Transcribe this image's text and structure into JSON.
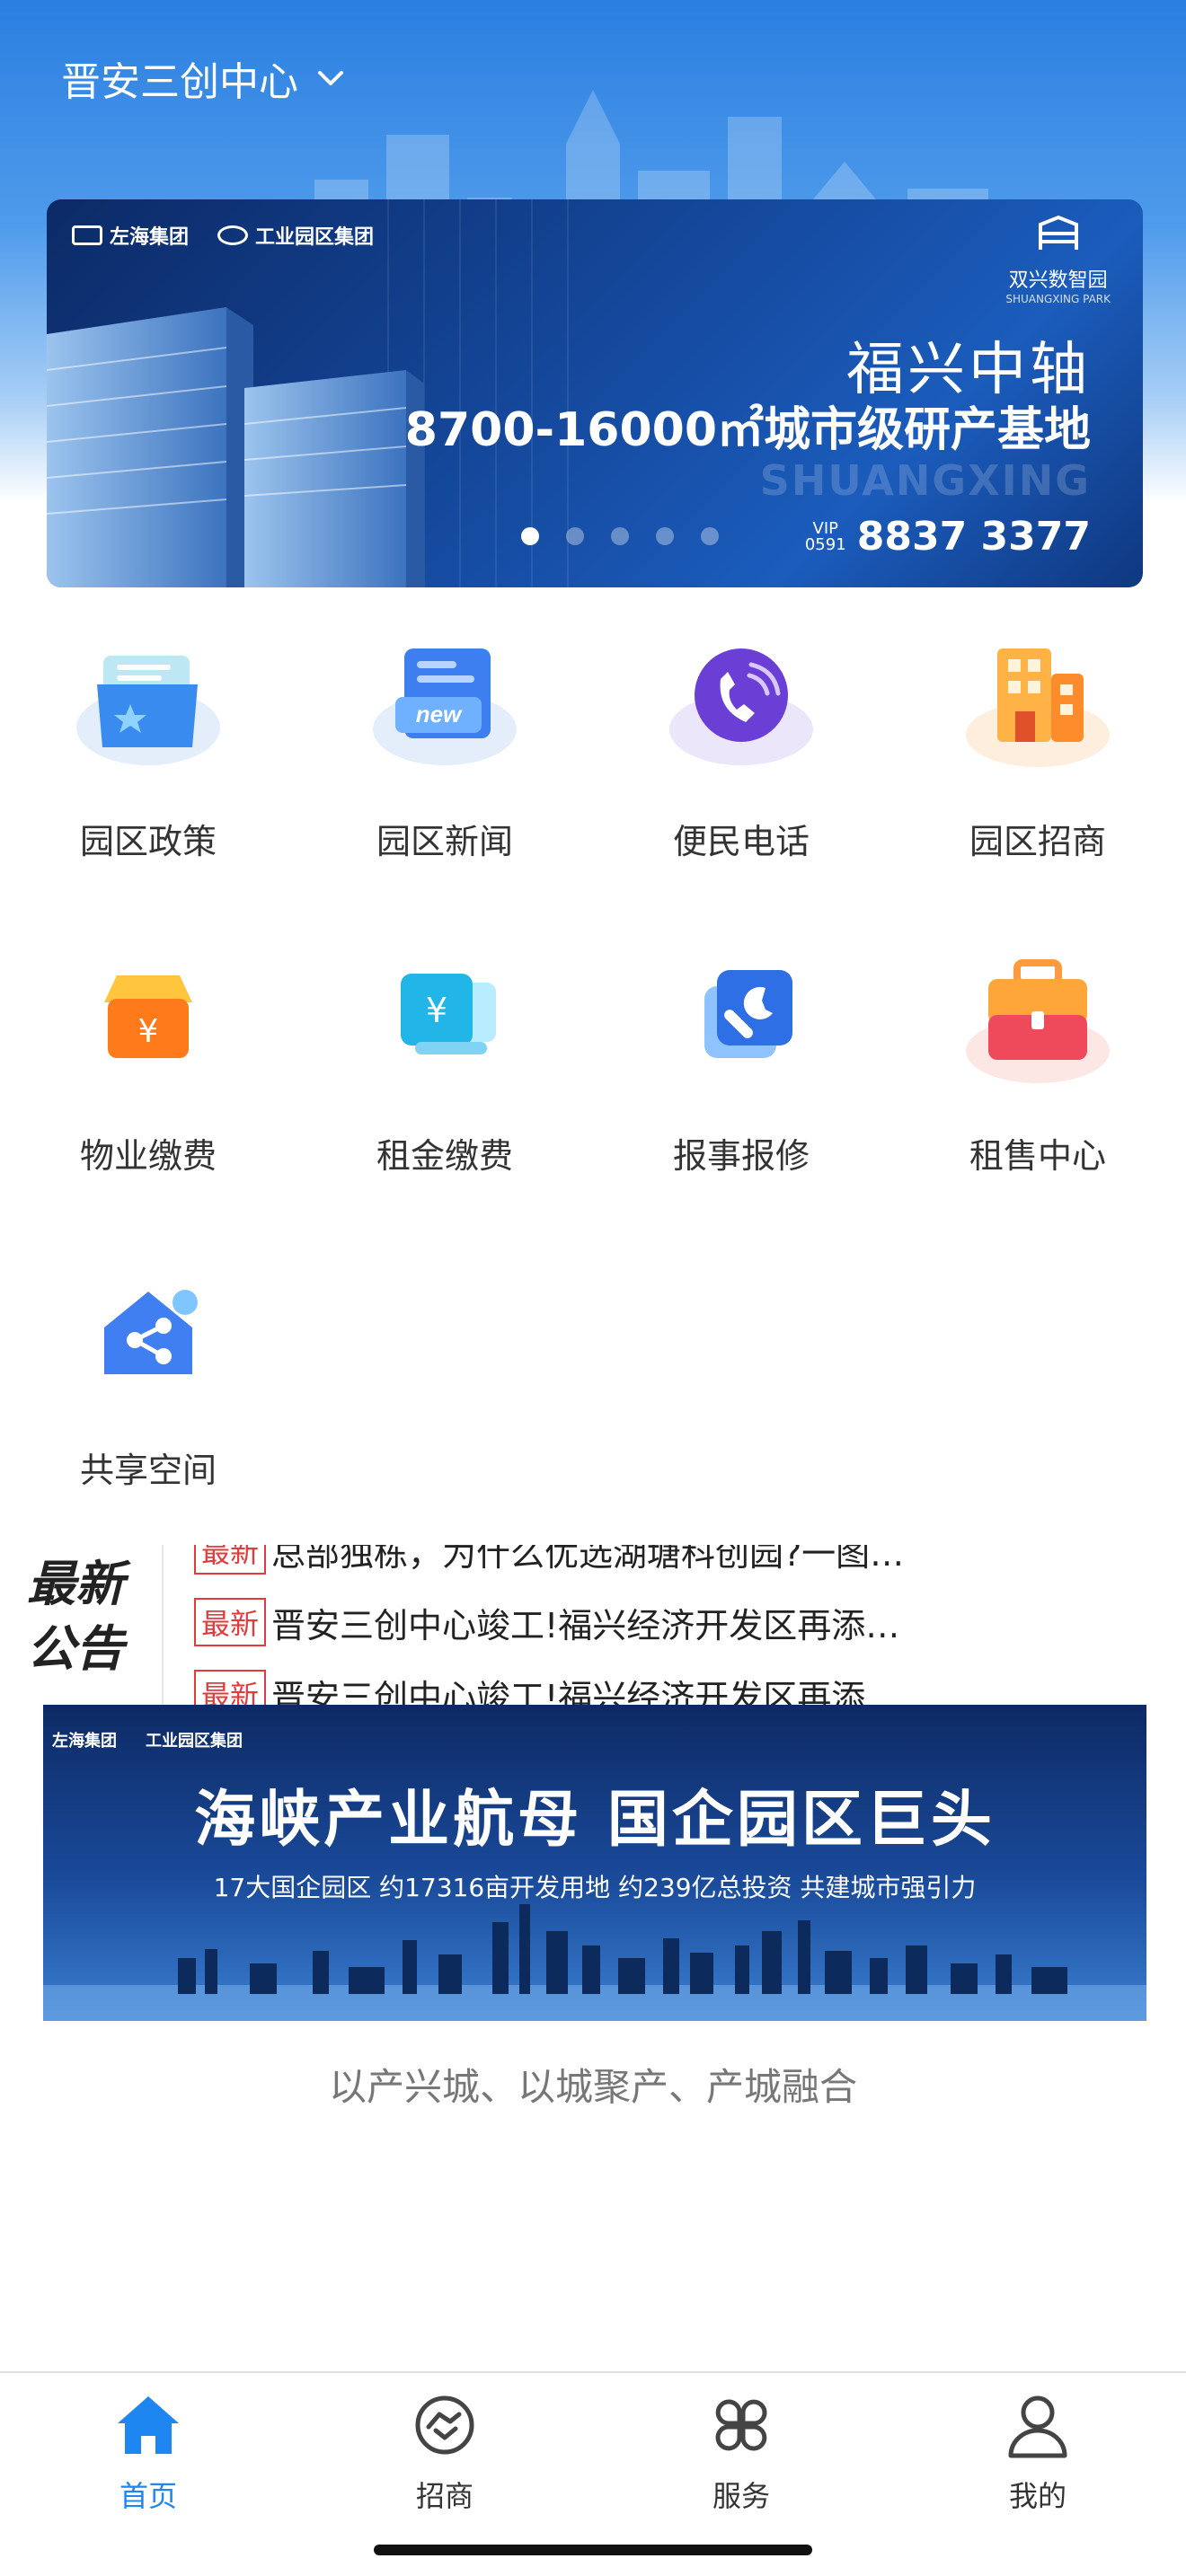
{
  "header": {
    "city": "晋安三创中心"
  },
  "banner": {
    "logos": [
      "左海集团",
      "工业园区集团"
    ],
    "brand": "双兴数智园",
    "brand_en": "SHUANGXING PARK",
    "title": "福兴中轴",
    "subtitle": "8700-16000㎡城市级研产基地",
    "watermark": "SHUANGXING",
    "phone_prefix": "VIP 0591",
    "phone": "8837 3377",
    "active_slide": 1,
    "slides": 5
  },
  "grid": [
    {
      "label": "园区政策",
      "icon": "policy-folder-icon"
    },
    {
      "label": "园区新闻",
      "icon": "news-icon"
    },
    {
      "label": "便民电话",
      "icon": "phone-icon"
    },
    {
      "label": "园区招商",
      "icon": "building-icon"
    },
    {
      "label": "物业缴费",
      "icon": "property-fee-icon"
    },
    {
      "label": "租金缴费",
      "icon": "rent-fee-icon"
    },
    {
      "label": "报事报修",
      "icon": "repair-wrench-icon"
    },
    {
      "label": "租售中心",
      "icon": "briefcase-icon"
    },
    {
      "label": "共享空间",
      "icon": "share-icon"
    }
  ],
  "notice": {
    "badge_line1": "最新",
    "badge_line2": "公告",
    "items": [
      {
        "tag": "最新",
        "text": "总部独栋，为什么优选湖塘科创园?一图…"
      },
      {
        "tag": "最新",
        "text": "晋安三创中心竣工!福兴经济开发区再添…"
      }
    ]
  },
  "banner2": {
    "logos": [
      "左海集团",
      "工业园区集团"
    ],
    "title": "海峡产业航母  国企园区巨头",
    "subtitle": "17大国企园区  约17316亩开发用地  约239亿总投资  共建城市强引力"
  },
  "tagline": "以产兴城、以城聚产、产城融合",
  "tabbar": [
    {
      "label": "首页",
      "icon": "home-icon",
      "active": true
    },
    {
      "label": "招商",
      "icon": "handshake-icon",
      "active": false
    },
    {
      "label": "服务",
      "icon": "services-grid-icon",
      "active": false
    },
    {
      "label": "我的",
      "icon": "user-icon",
      "active": false
    }
  ],
  "colors": {
    "accent": "#1d86f0",
    "tag": "#e23b3b",
    "header_bg": "#2a7fe0"
  }
}
